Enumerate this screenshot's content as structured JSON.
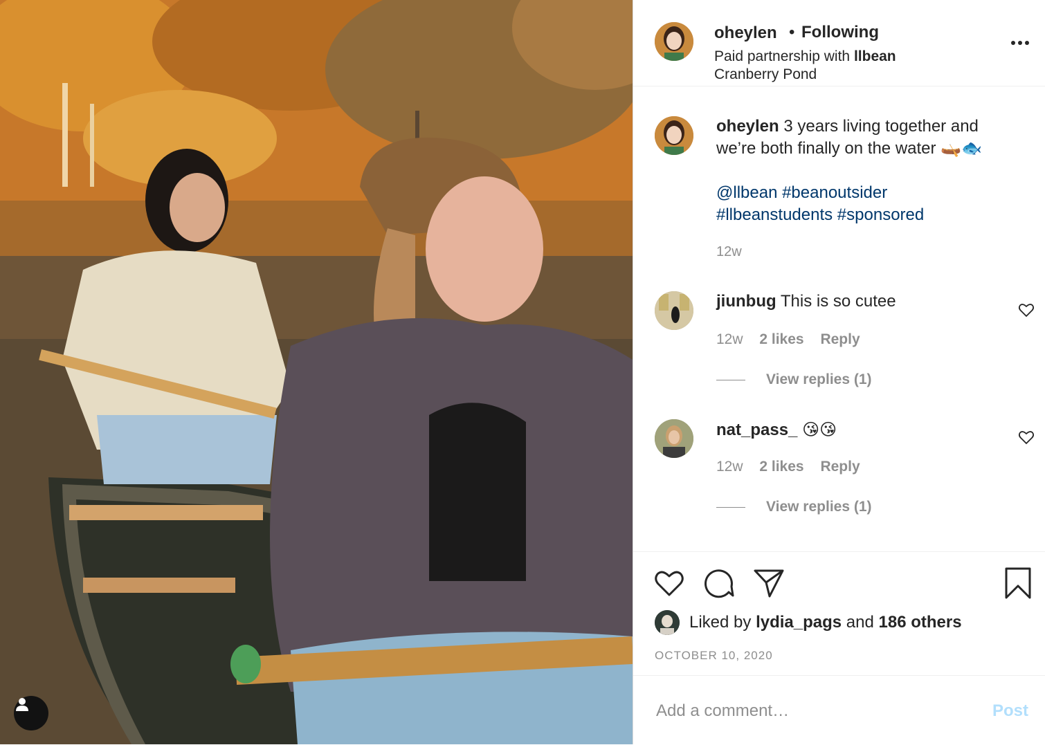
{
  "post": {
    "username": "oheylen",
    "dot": "•",
    "follow_status": "Following",
    "partnership_prefix": "Paid partnership with",
    "partner": "llbean",
    "location": "Cranberry Pond"
  },
  "caption": {
    "username": "oheylen",
    "text": "3 years living together and we’re both finally on the water 🛶🐟",
    "tags": [
      "@llbean #beanoutsider",
      "#llbeanstudents #sponsored"
    ],
    "time": "12w"
  },
  "comments": [
    {
      "username": "jiunbug",
      "text": "This is so cutee",
      "time": "12w",
      "likes": "2 likes",
      "reply": "Reply",
      "view_replies": "View replies (1)"
    },
    {
      "username": "nat_pass_",
      "text": "😘😘",
      "time": "12w",
      "likes": "2 likes",
      "reply": "Reply",
      "view_replies": "View replies (1)"
    }
  ],
  "likes": {
    "prefix": "Liked by",
    "user": "lydia_pags",
    "middle": "and",
    "others": "186 others"
  },
  "date": "OCTOBER 10, 2020",
  "add_comment": {
    "placeholder": "Add a comment…",
    "post_label": "Post"
  },
  "colors": {
    "link": "#00376b",
    "muted": "#8e8e8e",
    "post_disabled": "#b2dffc"
  },
  "icons": [
    "more-options-icon",
    "heart-icon",
    "comment-icon",
    "share-icon",
    "bookmark-icon",
    "user-tag-icon"
  ]
}
